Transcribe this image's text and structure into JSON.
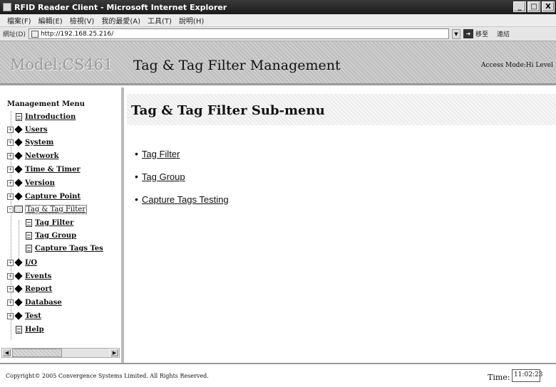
{
  "window": {
    "title": "RFID Reader Client - Microsoft Internet Explorer",
    "controls": [
      "_",
      "□",
      "X"
    ]
  },
  "menubar": {
    "items": [
      "檔案(F)",
      "編輯(E)",
      "檢視(V)",
      "我的最愛(A)",
      "工具(T)",
      "說明(H)"
    ]
  },
  "addressbar": {
    "label": "網址(D)",
    "url": "http://192.168.25.216/",
    "go_label": "移至",
    "links_label": "連結"
  },
  "banner": {
    "model": "Model:CS461",
    "page_title": "Tag & Tag Filter Management",
    "access_mode": "Access Mode:Hi Level"
  },
  "sidebar": {
    "heading": "Management Menu",
    "items": [
      {
        "label": "Introduction"
      },
      {
        "label": "Users"
      },
      {
        "label": "System"
      },
      {
        "label": "Network"
      },
      {
        "label": "Time & Timer"
      },
      {
        "label": "Version"
      },
      {
        "label": "Capture Point"
      },
      {
        "label": "Tag & Tag Filter"
      },
      {
        "label": "Tag Filter"
      },
      {
        "label": "Tag Group"
      },
      {
        "label": "Capture Tags Tes"
      },
      {
        "label": "I/O"
      },
      {
        "label": "Events"
      },
      {
        "label": "Report"
      },
      {
        "label": "Database"
      },
      {
        "label": "Test"
      },
      {
        "label": "Help"
      }
    ]
  },
  "main": {
    "subtitle": "Tag & Tag Filter Sub-menu",
    "links": [
      "Tag Filter",
      "Tag Group",
      "Capture Tags Testing"
    ]
  },
  "footer": {
    "copyright": "Copyright© 2005 Convergence Systems Limited. All Rights Reserved.",
    "time_label": "Time:",
    "time_value": "11:02:23"
  }
}
